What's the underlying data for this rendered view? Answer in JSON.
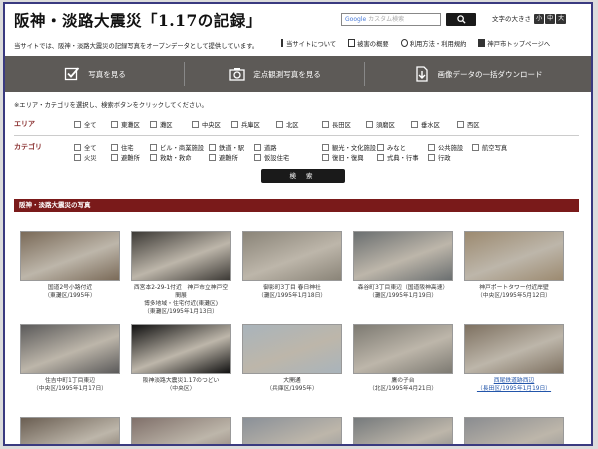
{
  "header": {
    "title": "阪神・淡路大震災「1.17の記録」",
    "search_placeholder": "カスタム検索",
    "search_google": "Google",
    "font_size_label": "文字の大きさ",
    "font_size_buttons": [
      "小",
      "中",
      "大"
    ]
  },
  "intro": "当サイトでは、阪神・淡路大震災の記録写真をオープンデータとして提供しています。",
  "links": [
    "当サイトについて",
    "被害の概要",
    "利用方法・利用規約",
    "神戸市トップページへ"
  ],
  "nav": [
    "写真を見る",
    "定点観測写真を見る",
    "画像データの一括ダウンロード"
  ],
  "instruction": "※エリア・カテゴリを選択し、検索ボタンをクリックしてください。",
  "area": {
    "label": "エリア",
    "items": [
      "全て",
      "東灘区",
      "灘区",
      "中央区",
      "兵庫区",
      "北区",
      "長田区",
      "須磨区",
      "垂水区",
      "西区"
    ]
  },
  "category": {
    "label": "カテゴリ",
    "row1": [
      "全て",
      "住宅",
      "ビル・商業施設",
      "鉄道・駅",
      "道路",
      "観光・文化施設",
      "みなと",
      "公共施設",
      "航空写真"
    ],
    "row2": [
      "火災",
      "避難所",
      "救助・救命",
      "避難所",
      "仮設住宅",
      "復旧・復興",
      "式典・行事",
      "行政"
    ]
  },
  "search_button": "検 索",
  "section_title": "阪神・淡路大震災の写真",
  "photos": [
    {
      "caption": [
        "国道2号小路付近",
        "（東灘区/1995年）"
      ],
      "color": "#7a6a58"
    },
    {
      "caption": [
        "西宮本2-29-1付近　神戸市立神戸空間展",
        "博多地域・住宅付近(東灘区)",
        "（東灘区/1995年1月13日）"
      ],
      "color": "#3d3a36"
    },
    {
      "caption": [
        "御影町3丁目 春日神社",
        "（灘区/1995年1月18日）"
      ],
      "color": "#8a8478"
    },
    {
      "caption": [
        "森谷町3丁目東辺（国道阪神高速）",
        "（灘区/1995年1月19日）"
      ],
      "color": "#6b6f70"
    },
    {
      "caption": [
        "神戸ポートタワー付近岸壁",
        "（中央区/1995年5月12日）"
      ],
      "color": "#9c8a70"
    },
    {
      "caption": [
        "住吉中町1丁目東辺",
        "（中央区/1995年1月17日）"
      ],
      "color": "#5b5a5a"
    },
    {
      "caption": [
        "阪神淡路大震災1.17のつどい",
        "（中央区）"
      ],
      "color": "#111111"
    },
    {
      "caption": [
        "大開通",
        "（兵庫区/1995年）"
      ],
      "color": "#a9b4bb"
    },
    {
      "caption": [
        "鷹の子台",
        "（北区/1995年4月21日）"
      ],
      "color": "#7d7a72"
    },
    {
      "caption": [
        "西尾鉄道跡西辺",
        "（長田区/1995年1月19日）"
      ],
      "color": "#7e7161",
      "link": true
    },
    {
      "caption": [
        ""
      ],
      "color": "#6a5e52"
    },
    {
      "caption": [
        ""
      ],
      "color": "#80706a"
    },
    {
      "caption": [
        ""
      ],
      "color": "#8a9098"
    },
    {
      "caption": [
        ""
      ],
      "color": "#767a7c"
    },
    {
      "caption": [
        ""
      ],
      "color": "#8a8c90"
    }
  ],
  "colors": {
    "nav_bg": "#5d5a57",
    "section_bg": "#7a1a1a",
    "filter_label": "#8a3030"
  }
}
